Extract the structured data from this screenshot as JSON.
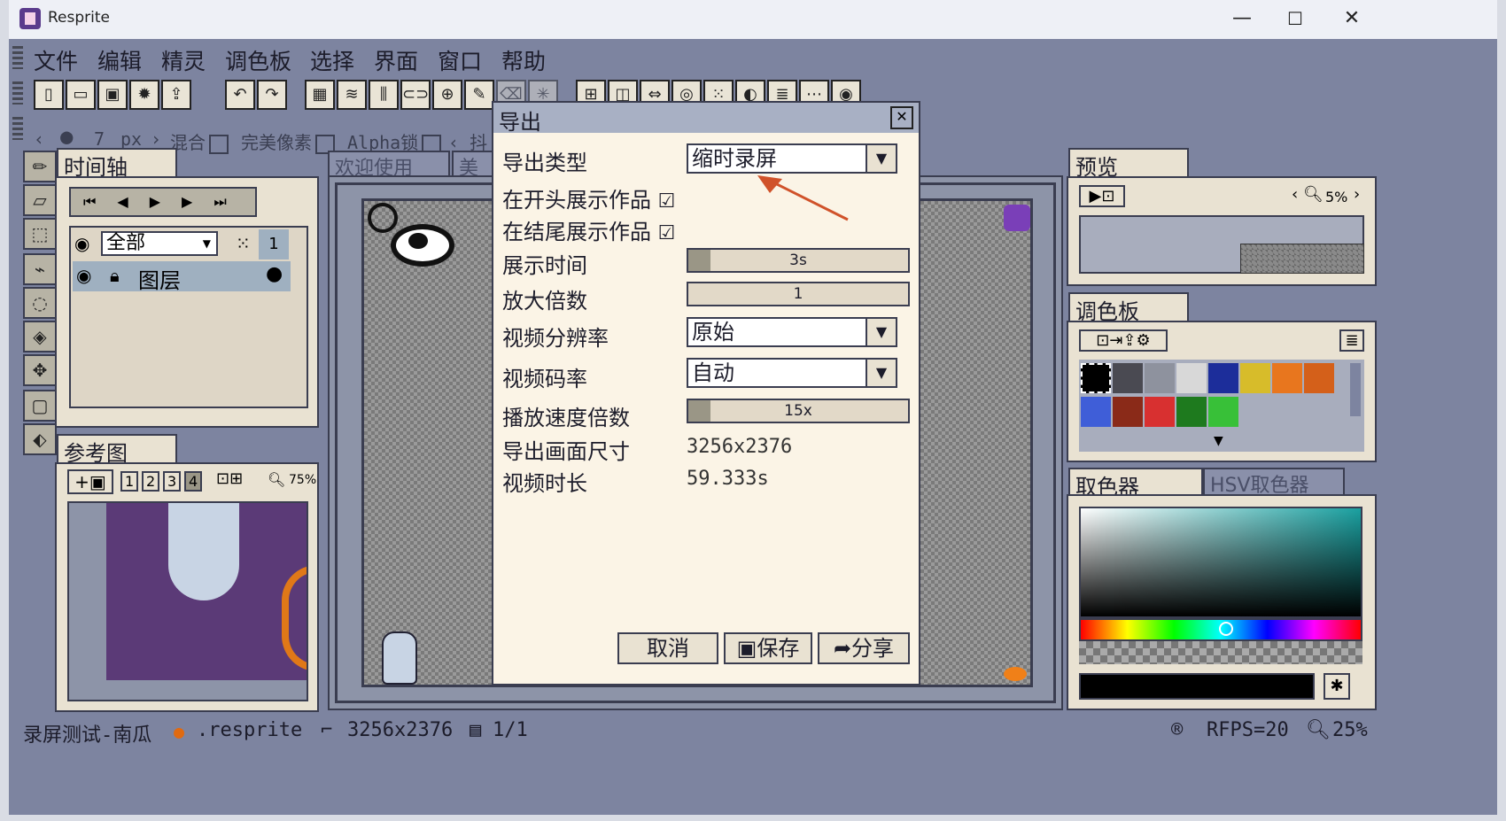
{
  "window": {
    "title": "Resprite",
    "min": "—",
    "max": "☐",
    "close": "✕"
  },
  "menu": [
    "文件",
    "编辑",
    "精灵",
    "调色板",
    "选择",
    "界面",
    "窗口",
    "帮助"
  ],
  "toolbar_icons": [
    "new-file",
    "open-folder",
    "save",
    "settings",
    "export",
    "undo",
    "redo",
    "grid",
    "layers",
    "columns",
    "link",
    "merge",
    "pen",
    "eraser",
    "sparkle",
    "pixel",
    "frames",
    "tiles",
    "mirror",
    "dots",
    "palette",
    "stack"
  ],
  "options": {
    "size_value": "7",
    "size_unit": "px",
    "blend": "混合",
    "pixel_perfect": "完美像素",
    "alpha_lock": "Alpha锁",
    "more": "‹ 抖"
  },
  "timeline": {
    "tab": "时间轴",
    "filter": "全部",
    "frame": "1",
    "layer_name": "图层"
  },
  "reference": {
    "tab": "参考图",
    "nums": [
      "1",
      "2",
      "3",
      "4"
    ],
    "zoom": "75%"
  },
  "canvas_tabs": [
    "欢迎使用",
    "美"
  ],
  "preview": {
    "tab": "预览",
    "zoom": "5%"
  },
  "palette": {
    "tab": "调色板",
    "colors": [
      "#000000",
      "#4a4a52",
      "#8e929e",
      "#d8d8d8",
      "#1c2d9a",
      "#d7bc2a",
      "#e8761e",
      "#d4601a",
      "#3f5ed8",
      "#8a2a18",
      "#d83030",
      "#1e7a1e",
      "#38c038"
    ]
  },
  "color_picker": {
    "tab": "取色器",
    "tab2": "HSV取色器"
  },
  "dialog": {
    "title": "导出",
    "close": "✕",
    "export_type_label": "导出类型",
    "export_type_value": "缩时录屏",
    "show_start": "在开头展示作品",
    "show_end": "在结尾展示作品",
    "show_time_label": "展示时间",
    "show_time_value": "3s",
    "show_time_fill": 0.1,
    "scale_label": "放大倍数",
    "scale_value": "1",
    "resolution_label": "视频分辨率",
    "resolution_value": "原始",
    "bitrate_label": "视频码率",
    "bitrate_value": "自动",
    "speed_label": "播放速度倍数",
    "speed_value": "15x",
    "speed_fill": 0.1,
    "size_label": "导出画面尺寸",
    "size_value": "3256x2376",
    "duration_label": "视频时长",
    "duration_value": "59.333s",
    "cancel": "取消",
    "save": "保存",
    "share": "分享"
  },
  "status": {
    "filename": "录屏测试-南瓜",
    "ext": ".resprite",
    "dims": "3256x2376",
    "frames": "1/1",
    "rfps": "RFPS=20",
    "zoom": "25%"
  }
}
